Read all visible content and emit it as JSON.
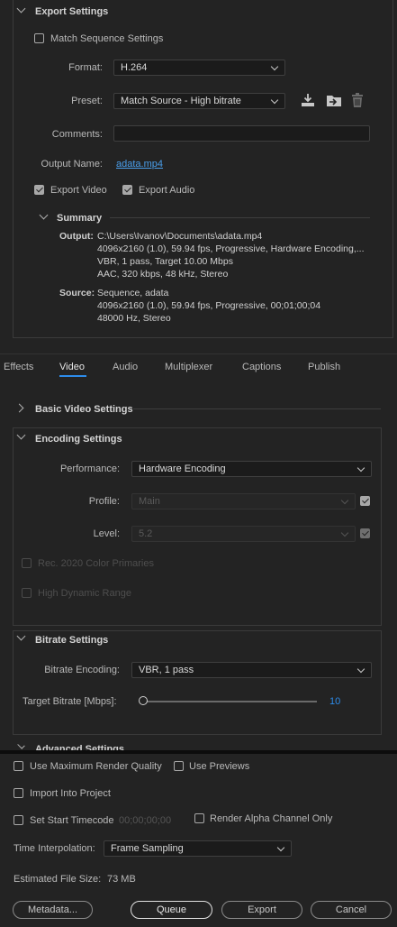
{
  "export_settings": {
    "title": "Export Settings",
    "match_sequence_label": "Match Sequence Settings",
    "match_sequence_checked": false,
    "format_label": "Format:",
    "format_value": "H.264",
    "preset_label": "Preset:",
    "preset_value": "Match Source - High bitrate",
    "comments_label": "Comments:",
    "comments_value": "",
    "output_name_label": "Output Name:",
    "output_name_value": "adata.mp4",
    "export_video_label": "Export Video",
    "export_video_checked": true,
    "export_audio_label": "Export Audio",
    "export_audio_checked": true
  },
  "summary": {
    "title": "Summary",
    "output_label": "Output:",
    "output_lines": [
      "C:\\Users\\Ivanov\\Documents\\adata.mp4",
      "4096x2160 (1.0), 59.94 fps, Progressive, Hardware Encoding,...",
      "VBR, 1 pass, Target 10.00 Mbps",
      "AAC, 320 kbps, 48 kHz, Stereo"
    ],
    "source_label": "Source:",
    "source_lines": [
      "Sequence, adata",
      "4096x2160 (1.0), 59.94 fps, Progressive, 00;01;00;04",
      "48000 Hz, Stereo"
    ]
  },
  "tabs": [
    "Effects",
    "Video",
    "Audio",
    "Multiplexer",
    "Captions",
    "Publish"
  ],
  "active_tab": "Video",
  "basic_video": {
    "title": "Basic Video Settings"
  },
  "encoding": {
    "title": "Encoding Settings",
    "performance_label": "Performance:",
    "performance_value": "Hardware Encoding",
    "profile_label": "Profile:",
    "profile_value": "Main",
    "level_label": "Level:",
    "level_value": "5.2",
    "rec2020_label": "Rec. 2020 Color Primaries",
    "hdr_label": "High Dynamic Range"
  },
  "bitrate": {
    "title": "Bitrate Settings",
    "encoding_label": "Bitrate Encoding:",
    "encoding_value": "VBR, 1 pass",
    "target_label": "Target Bitrate [Mbps]:",
    "target_value": "10",
    "target_fraction": 0.0
  },
  "advanced": {
    "title": "Advanced Settings"
  },
  "bottom": {
    "max_render_label": "Use Maximum Render Quality",
    "use_previews_label": "Use Previews",
    "import_label": "Import Into Project",
    "start_tc_label": "Set Start Timecode",
    "start_tc_value": "00;00;00;00",
    "render_alpha_label": "Render Alpha Channel Only",
    "interp_label": "Time Interpolation:",
    "interp_value": "Frame Sampling",
    "file_size_label": "Estimated File Size:",
    "file_size_value": "73 MB"
  },
  "buttons": {
    "metadata": "Metadata...",
    "queue": "Queue",
    "export": "Export",
    "cancel": "Cancel"
  },
  "colors": {
    "accent": "#2d8ceb",
    "link": "#4a9eea",
    "background": "#232323"
  },
  "icons": [
    "save-preset-icon",
    "import-preset-icon",
    "delete-preset-icon"
  ]
}
